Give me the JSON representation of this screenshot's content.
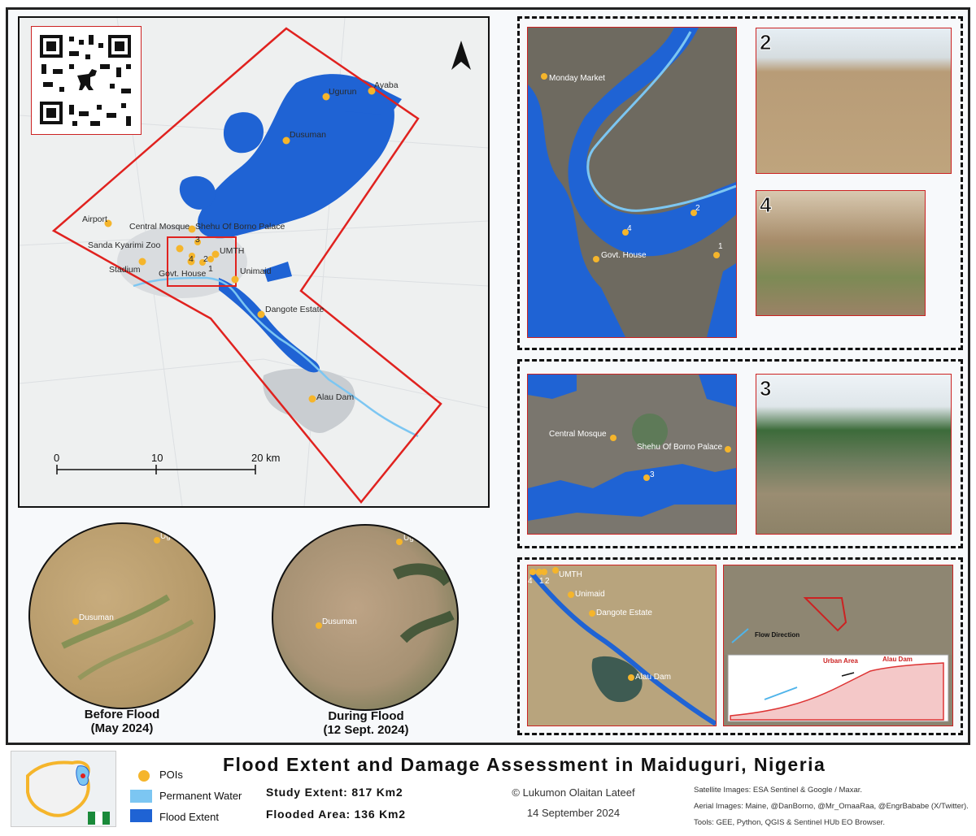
{
  "title": "Flood Extent and Damage Assessment in Maiduguri, Nigeria",
  "main_map": {
    "pois": [
      {
        "name": "Ayaba"
      },
      {
        "name": "Ugurun"
      },
      {
        "name": "Dusuman"
      },
      {
        "name": "Airport"
      },
      {
        "name": "Central Mosque"
      },
      {
        "name": "Shehu Of Borno Palace"
      },
      {
        "name": "Sanda Kyarimi Zoo"
      },
      {
        "name": "Stadium"
      },
      {
        "name": "Govt. House"
      },
      {
        "name": "UMTH"
      },
      {
        "name": "Unimaid"
      },
      {
        "name": "Dangote Estate"
      },
      {
        "name": "Alau Dam"
      }
    ],
    "numbered_points": [
      "1",
      "2",
      "3",
      "4"
    ],
    "scale_bar": {
      "ticks": [
        "0",
        "10",
        "20 km"
      ]
    },
    "north_arrow": "north-arrow-icon",
    "colors": {
      "flood": "#1f63d4",
      "permanent_water": "#7cc6f2",
      "boundary": "#e0221f",
      "poi": "#f5b52b"
    }
  },
  "inset_1": {
    "labels": [
      "Monday Market",
      "Govt. House",
      "2",
      "4",
      "1"
    ],
    "photos": [
      "2",
      "4"
    ]
  },
  "inset_2": {
    "labels": [
      "Central Mosque",
      "Shehu Of Borno Palace",
      "3"
    ],
    "photos": [
      "3"
    ]
  },
  "inset_3": {
    "labels": [
      "UMTH",
      "Unimaid",
      "Dangote Estate",
      "Alau Dam",
      "4",
      "1",
      "2"
    ],
    "profile_labels": {
      "flow": "Flow Direction",
      "urban": "Urban Area",
      "dam": "Alau Dam"
    }
  },
  "before_after": {
    "before": {
      "caption_line1": "Before Flood",
      "caption_line2": "(May 2024)",
      "labels": [
        "Ugurun",
        "Dusuman"
      ]
    },
    "during": {
      "caption_line1": "During Flood",
      "caption_line2": "(12 Sept. 2024)",
      "labels": [
        "Ugurun",
        "Dusuman"
      ]
    }
  },
  "legend": {
    "pois": "POIs",
    "permanent_water": "Permanent Water",
    "flood_extent": "Flood Extent"
  },
  "stats": {
    "study_extent": "Study Extent: 817 Km2",
    "flooded_area": "Flooded Area: 136 Km2"
  },
  "author": {
    "name": "© Lukumon Olaitan Lateef",
    "date": "14 September 2024"
  },
  "credits": {
    "satellite": "Satellite Images: ESA Sentinel & Google / Maxar.",
    "aerial": "Aerial Images: Maine, @DanBorno, @Mr_OmaaRaa, @EngrBababe (X/Twitter).",
    "tools": "Tools: GEE, Python, QGIS & Sentinel HUb EO Browser."
  }
}
